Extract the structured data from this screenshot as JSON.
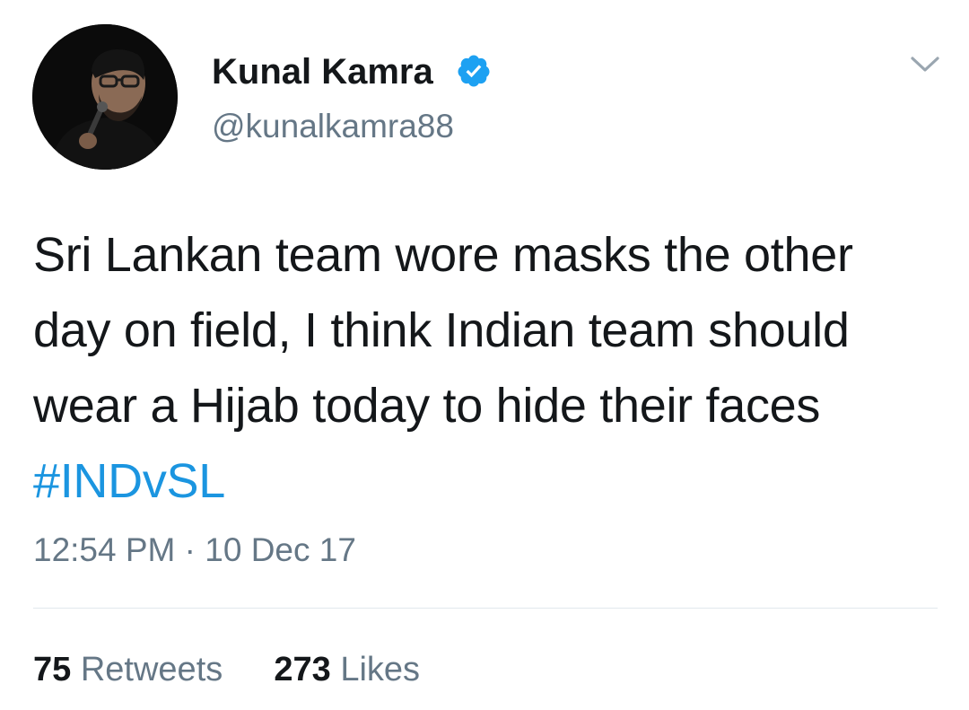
{
  "user": {
    "display_name": "Kunal Kamra",
    "handle": "@kunalkamra88",
    "verified": true
  },
  "tweet": {
    "text": "Sri Lankan team wore masks the other day on field, I think Indian team should wear a Hijab today to hide their faces",
    "hashtag": "#INDvSL",
    "time": "12:54 PM",
    "separator": "·",
    "date": "10 Dec 17"
  },
  "stats": {
    "retweets_count": "75",
    "retweets_label": "Retweets",
    "likes_count": "273",
    "likes_label": "Likes"
  },
  "icons": {
    "verified": "verified-badge-icon",
    "menu": "chevron-down-icon"
  },
  "colors": {
    "link": "#1b95e0",
    "verified": "#1da1f2",
    "secondary_text": "#657786",
    "primary_text": "#14171a",
    "divider": "#e1e8ed"
  }
}
